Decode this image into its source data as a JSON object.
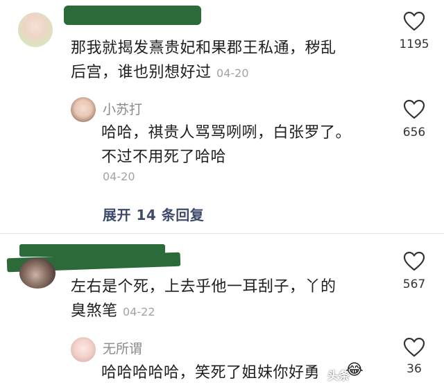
{
  "comments": [
    {
      "text_line1": "那我就揭发熹贵妃和果郡王私通，秽乱",
      "text_line2": "后宫，谁也别想好过",
      "date": "04-20",
      "likes": "1195",
      "reply": {
        "username": "小苏打",
        "text_line1": "哈哈，祺贵人骂骂咧咧，白张罗了。",
        "text_line2": "不过不用死了哈哈",
        "date": "04-20",
        "likes": "656"
      },
      "expand_label": "展开 14 条回复"
    },
    {
      "text_line1": "左右是个死，上去乎他一耳刮子，丫的",
      "text_line2": "臭煞笔",
      "date": "04-22",
      "likes": "567",
      "reply": {
        "username": "无所谓",
        "text_line1": "哈哈哈哈哈，笑死了姐妹你好勇",
        "likes": "36"
      }
    }
  ],
  "watermark": "头条"
}
